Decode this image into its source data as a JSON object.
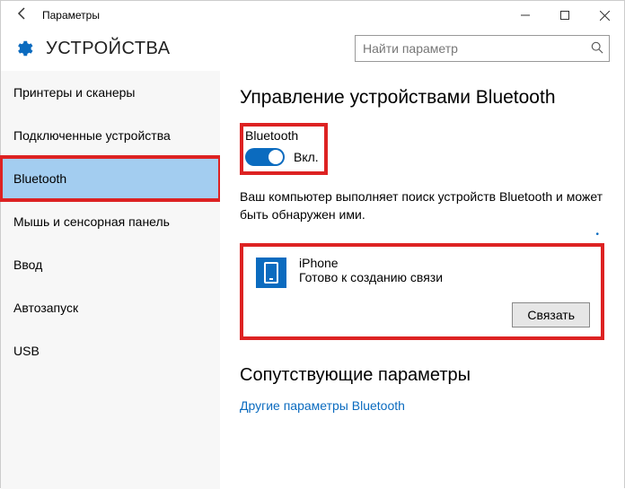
{
  "titlebar": {
    "title": "Параметры"
  },
  "header": {
    "heading": "УСТРОЙСТВА",
    "search_placeholder": "Найти параметр"
  },
  "sidebar": {
    "items": [
      {
        "label": "Принтеры и сканеры"
      },
      {
        "label": "Подключенные устройства"
      },
      {
        "label": "Bluetooth"
      },
      {
        "label": "Мышь и сенсорная панель"
      },
      {
        "label": "Ввод"
      },
      {
        "label": "Автозапуск"
      },
      {
        "label": "USB"
      }
    ],
    "selected_index": 2
  },
  "content": {
    "page_title": "Управление устройствами Bluetooth",
    "bluetooth_label": "Bluetooth",
    "toggle_state": "Вкл.",
    "description": "Ваш компьютер выполняет поиск устройств Bluetooth и может быть обнаружен ими.",
    "device": {
      "name": "iPhone",
      "status": "Готово к созданию связи",
      "pair_button": "Связать"
    },
    "related_heading": "Сопутствующие параметры",
    "related_link": "Другие параметры Bluetooth"
  }
}
